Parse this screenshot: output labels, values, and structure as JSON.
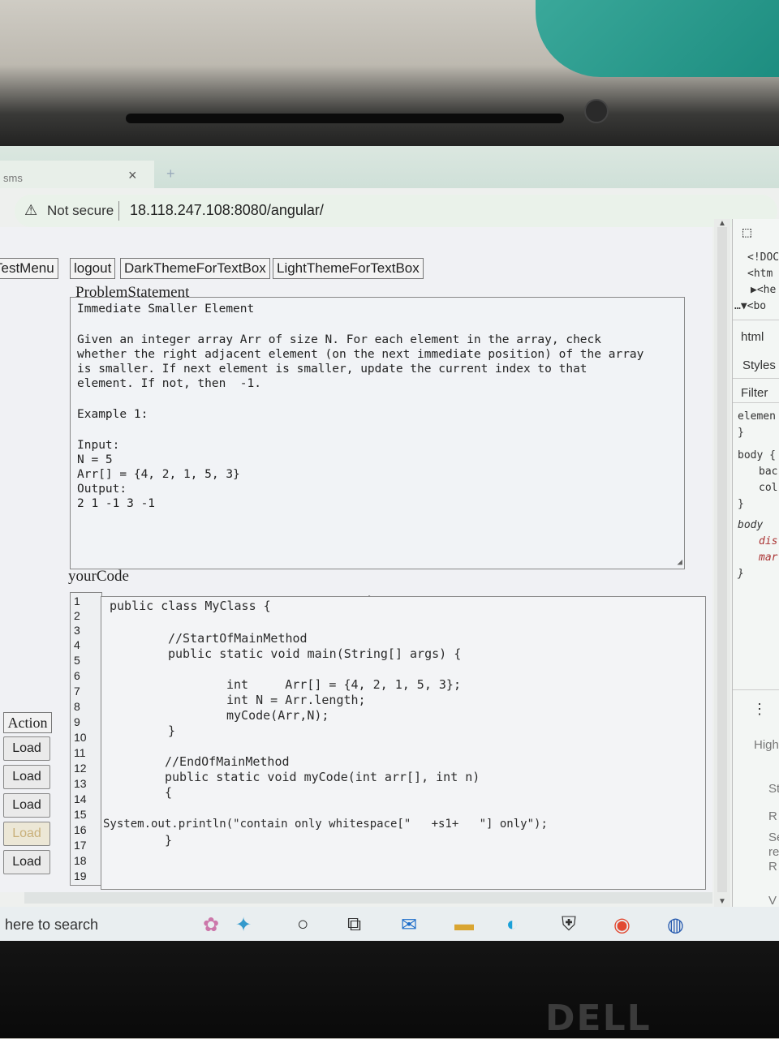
{
  "browser": {
    "tab_title": "sms",
    "tab_close": "×",
    "new_tab": "+",
    "security_label": "Not secure",
    "url": "18.118.247.108:8080/angular/"
  },
  "menu": [
    "TestMenu",
    "logout",
    "DarkThemeForTextBox",
    "LightThemeForTextBox"
  ],
  "problem": {
    "heading": "ProblemStatement",
    "lines": [
      "Immediate Smaller Element",
      "Given an integer array Arr of size N. For each element in the array, check",
      "whether the right adjacent element (on the next immediate position) of the array",
      "is smaller. If next element is smaller, update the current index to that",
      "element. If not, then  -1.",
      "Example 1:",
      "Input:",
      "N = 5",
      "Arr[] = {4, 2, 1, 5, 3}",
      "Output:",
      "2 1 -1 3 -1"
    ]
  },
  "code_section": {
    "heading": "yourCode",
    "line_numbers": [
      "1",
      "2",
      "3",
      "4",
      "5",
      "6",
      "7",
      "8",
      "9",
      "10",
      "11",
      "12",
      "13",
      "14",
      "15",
      "16",
      "17",
      "18",
      "19"
    ],
    "code_lines": [
      "public class MyClass {",
      "//StartOfMainMethod",
      "public static void main(String[] args) {",
      "int     Arr[] = {4, 2, 1, 5, 3};",
      "int N = Arr.length;",
      "myCode(Arr,N);",
      "}",
      "//EndOfMainMethod",
      "public static void myCode(int arr[], int n)",
      "{",
      "System.out.println(\"contain only whitespace[\"   +s1+   \"] only\");",
      "}"
    ]
  },
  "actions": {
    "heading": "Action",
    "buttons": [
      "Load",
      "Load",
      "Load",
      "Load",
      "Load"
    ]
  },
  "devtools": {
    "source_lines": [
      "<!DOC",
      "<htm",
      "▶<he",
      "…▼<bo"
    ],
    "tabs": [
      "html",
      "Styles",
      "Filter"
    ],
    "style_lines": [
      "elemen",
      "}",
      "body {",
      "bac",
      "col",
      "}",
      "body",
      "dis",
      "mar",
      "}"
    ],
    "more": "⋮",
    "lower": [
      "High",
      "St",
      "R",
      "Se",
      "re",
      "R",
      "V"
    ]
  },
  "taskbar": {
    "search_placeholder": "here to search"
  },
  "laptop_brand": "DELL"
}
